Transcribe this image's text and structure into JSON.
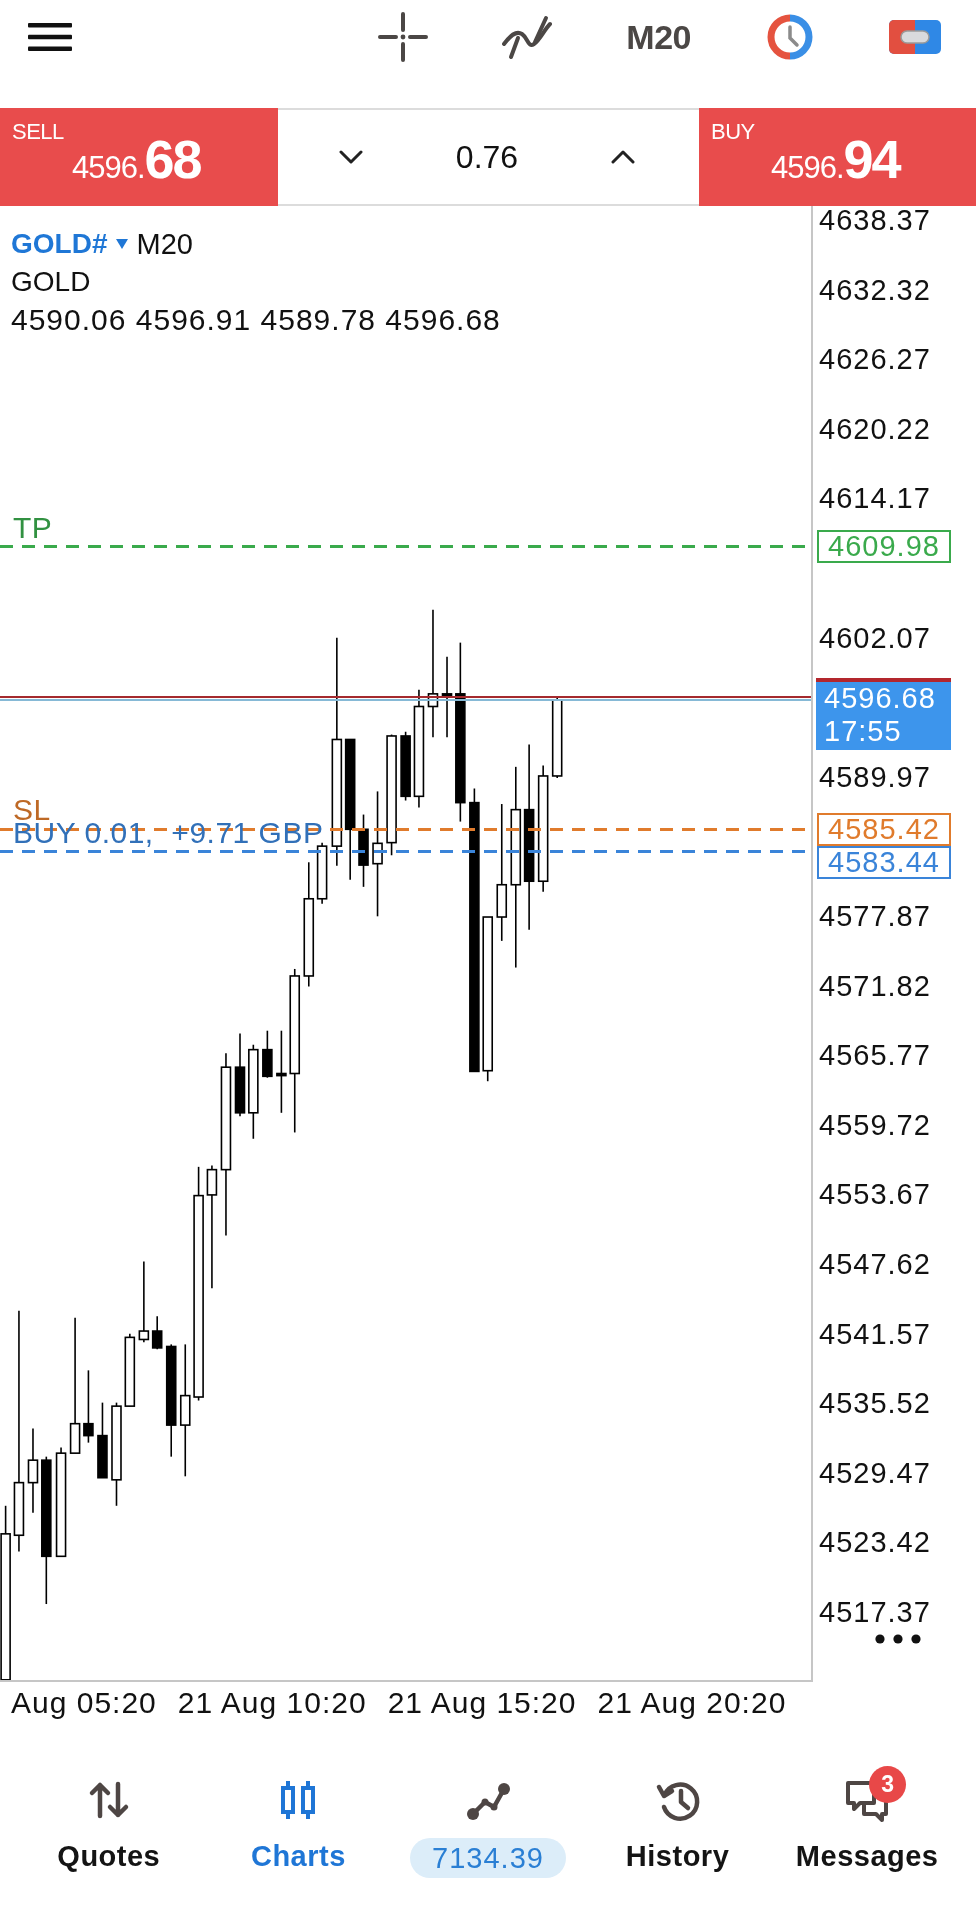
{
  "toolbar": {
    "timeframe": "M20"
  },
  "trade_panel": {
    "sell": {
      "label": "SELL",
      "price": "4596.**68**"
    },
    "volume": "0.76",
    "buy": {
      "label": "BUY",
      "price": "4596.**94**"
    }
  },
  "chart": {
    "symbol": "GOLD#",
    "timeframe": "M20",
    "description": "GOLD",
    "ohlc": "4590.06 4596.91 4589.78 4596.68",
    "price_scale": [
      "4638.37",
      "4632.32",
      "4626.27",
      "4620.22",
      "4614.17",
      "4602.07",
      "4589.97",
      "4577.87",
      "4571.82",
      "4565.77",
      "4559.72",
      "4553.67",
      "4547.62",
      "4541.57",
      "4535.52",
      "4529.47",
      "4523.42",
      "4517.37"
    ],
    "levels": [
      {
        "label": "TP",
        "price_tag": "4609.98",
        "color": "#3aaa4c"
      },
      {
        "label": "SL",
        "price_tag": "4585.42",
        "color": "#e07b2c"
      },
      {
        "label": "BUY 0.01,  +9.71 GBP",
        "price_tag": "4583.44",
        "color": "#3a84d9"
      }
    ],
    "current_price": {
      "price": "4596.68",
      "countdown": "17:55"
    },
    "time_scale": [
      "Aug 05:20",
      "21 Aug 10:20",
      "21 Aug 15:20",
      "21 Aug 20:20"
    ]
  },
  "nav": [
    {
      "label": "Quotes",
      "kind": "tab",
      "selected": false
    },
    {
      "label": "Charts",
      "kind": "tab",
      "selected": true
    },
    {
      "label": "7134.39",
      "kind": "balance",
      "selected": false
    },
    {
      "label": "History",
      "kind": "tab",
      "selected": false
    },
    {
      "label": "Messages",
      "kind": "tab",
      "selected": false,
      "badge": "3"
    }
  ]
}
